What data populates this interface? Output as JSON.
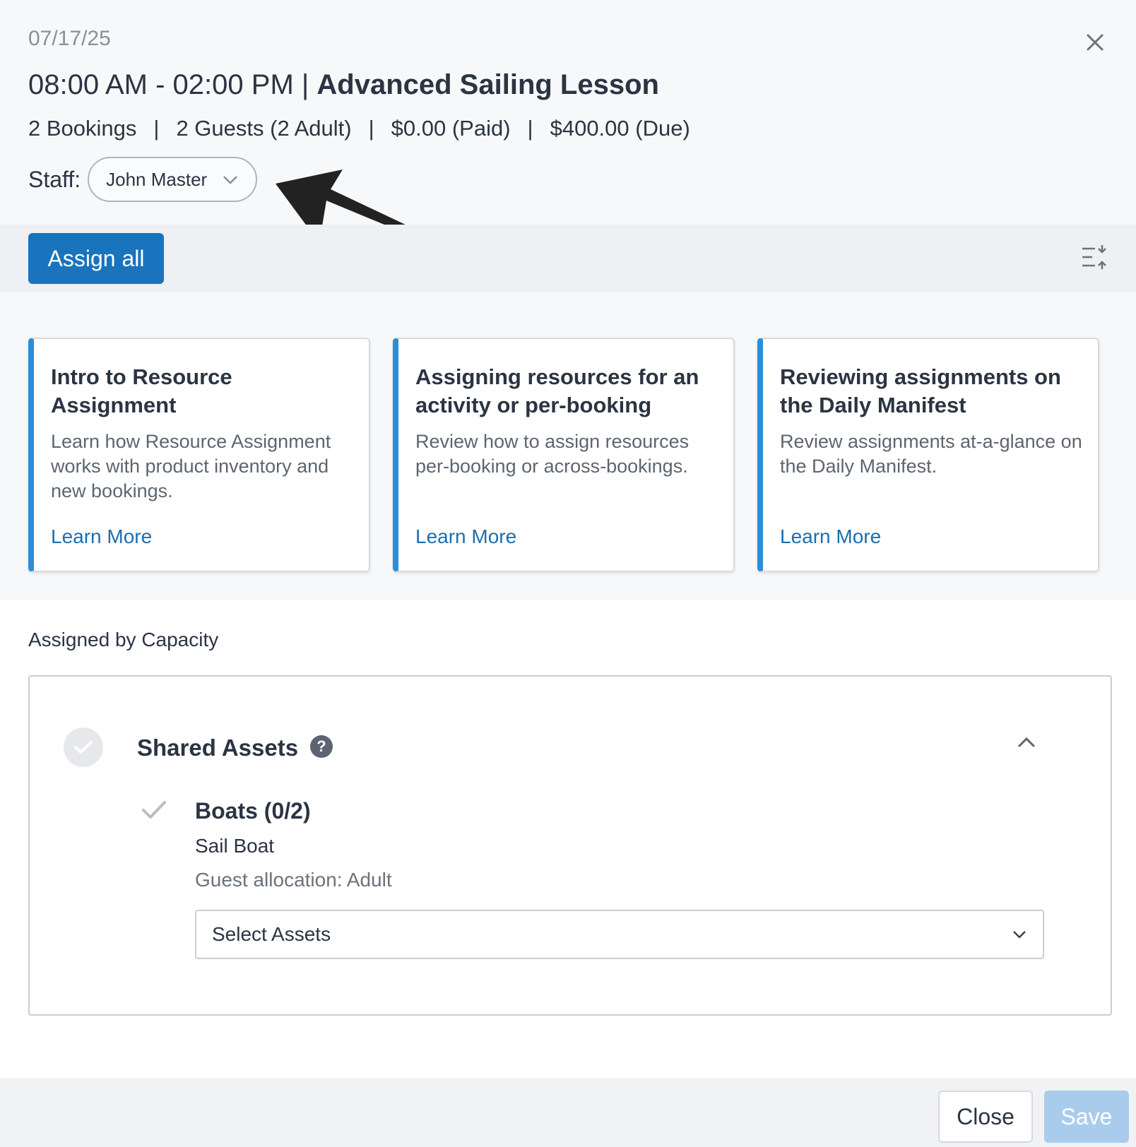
{
  "header": {
    "date": "07/17/25",
    "time_range": "08:00 AM - 02:00 PM | ",
    "activity_name": "Advanced Sailing Lesson",
    "summary": {
      "bookings": "2 Bookings",
      "guests": "2 Guests (2 Adult)",
      "paid": "$0.00 (Paid)",
      "due": "$400.00 (Due)",
      "separator": "|"
    },
    "staff_label": "Staff:",
    "staff_value": "John Master",
    "close_icon": "close-icon"
  },
  "toolbar": {
    "assign_all_label": "Assign all",
    "collapse_icon": "collapse-list-icon"
  },
  "help_cards": [
    {
      "title": "Intro to Resource Assignment",
      "description": "Learn how Resource Assignment works with product inventory and new bookings.",
      "link": "Learn More"
    },
    {
      "title": "Assigning resources for an activity or per-booking",
      "description": "Review how to assign resources per-booking or across-bookings.",
      "link": "Learn More"
    },
    {
      "title": "Reviewing assignments on the Daily Manifest",
      "description": "Review assignments at-a-glance on the Daily Manifest.",
      "link": "Learn More"
    }
  ],
  "capacity": {
    "section_label": "Assigned by Capacity",
    "group": {
      "title": "Shared Assets",
      "asset_name": "Boats (0/2)",
      "asset_type": "Sail Boat",
      "allocation": "Guest allocation: Adult",
      "select_placeholder": "Select Assets"
    }
  },
  "footer": {
    "close_label": "Close",
    "save_label": "Save"
  },
  "colors": {
    "primary": "#1a73bd",
    "card_accent": "#2a8fd8",
    "link": "#1a6fb0",
    "save_disabled": "#a9ccec"
  }
}
